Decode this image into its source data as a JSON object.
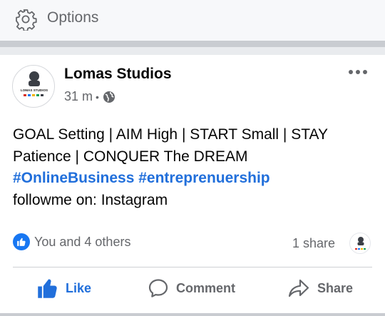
{
  "options": {
    "label": "Options"
  },
  "post": {
    "author": "Lomas Studios",
    "time": "31 m",
    "meta_separator": "•",
    "avatar_brand": "LOMAS STUDIOS",
    "lines": [
      "GOAL Setting | AIM High | START Small | STAY",
      "Patience | CONQUER The DREAM"
    ],
    "hashtags": [
      "#OnlineBusiness",
      "#entreprenuership"
    ],
    "follow_line": "followme on: Instagram",
    "reactions_text": "You and 4 others",
    "shares_text": "1 share"
  },
  "actions": {
    "like": "Like",
    "comment": "Comment",
    "share": "Share"
  },
  "colors": {
    "link_blue": "#216fdb",
    "like_badge": "#1877f2",
    "muted": "#65676b"
  },
  "icons": [
    "gear-icon",
    "globe-icon",
    "more-options-icon",
    "like-reaction-icon",
    "thumbs-up-icon",
    "comment-icon",
    "share-icon"
  ]
}
